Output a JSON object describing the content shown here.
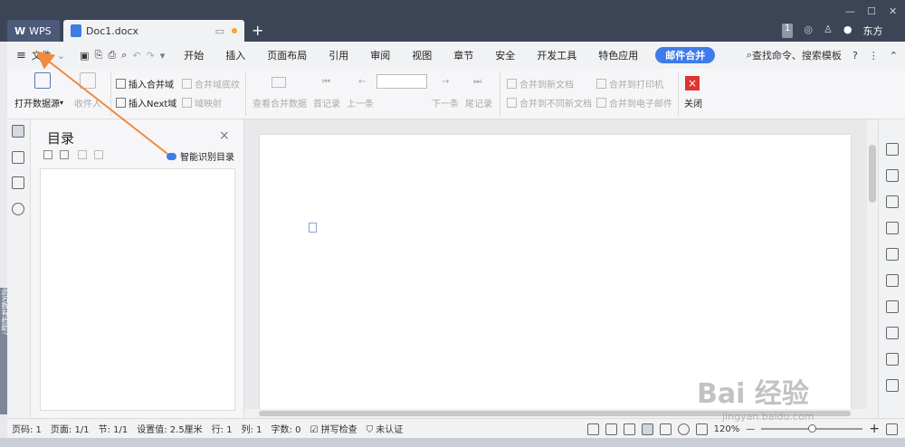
{
  "titlebar": {
    "tab_wps": "WPS",
    "tab_doc": "Doc1.docx",
    "new_tab": "+",
    "win_min": "—",
    "win_max": "☐",
    "win_close": "✕",
    "badge": "1",
    "user": "东方"
  },
  "menu": {
    "file_label": "文件",
    "items": [
      "开始",
      "插入",
      "页面布局",
      "引用",
      "审阅",
      "视图",
      "章节",
      "安全",
      "开发工具",
      "特色应用"
    ],
    "highlight": "邮件合并",
    "search": "查找命令、搜索模板",
    "help": "?"
  },
  "ribbon": {
    "open_source": "打开数据源",
    "recipients": "收件人",
    "insert_merge_field": "插入合并域",
    "insert_next": "插入Next域",
    "merge_field_shading": "合并域底纹",
    "field_map": "域映射",
    "view_merged": "查看合并数据",
    "first_record": "首记录",
    "prev": "上一条",
    "next": "下一条",
    "last_record": "尾记录",
    "merge_new_doc": "合并到新文档",
    "merge_diff_doc": "合并到不同新文档",
    "merge_printer": "合并到打印机",
    "merge_email": "合并到电子邮件",
    "close": "关闭"
  },
  "toc": {
    "title": "目录",
    "close": "×",
    "smart": "智能识别目录"
  },
  "status": {
    "page_no": "页码: 1",
    "page": "页面: 1/1",
    "section": "节: 1/1",
    "setting": "设置值: 2.5厘米",
    "row": "行: 1",
    "col": "列: 1",
    "words": "字数: 0",
    "spell": "拼写检查",
    "auth": "未认证",
    "zoom": "120%",
    "zoom_minus": "—",
    "zoom_plus": "+",
    "zoom_level": 0.5
  },
  "background": {
    "side_text": "此名数有档助?",
    "watermark_big": "Bai 经验",
    "watermark_small": "jingyan.baidu.com"
  },
  "colors": {
    "titlebar": "#3c4556",
    "accent": "#3f7bea",
    "annotation_arrow": "#f08a3c",
    "close_red": "#d33333"
  }
}
